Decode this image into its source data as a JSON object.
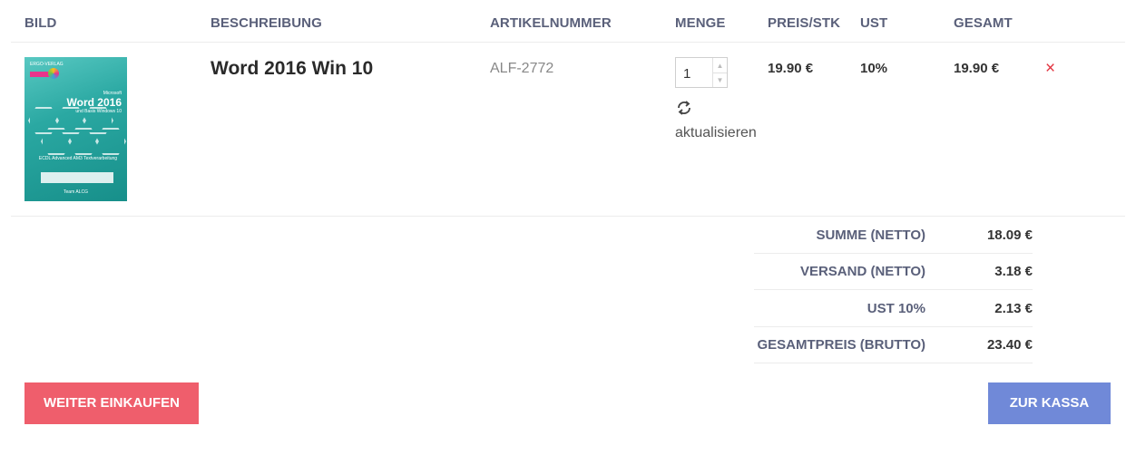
{
  "table": {
    "headers": [
      "BILD",
      "BESCHREIBUNG",
      "ARTIKELNUMMER",
      "MENGE",
      "PREIS/STK",
      "UST",
      "GESAMT"
    ]
  },
  "item": {
    "cover": {
      "publisher": "ERGO-VERLAG",
      "brand": "Microsoft",
      "title": "Word 2016",
      "subtitle": "und Basis Windows 10",
      "series": "ECDL Advanced AM3 Textverarbeitung",
      "author": "Team ALCG"
    },
    "description": "Word 2016 Win 10",
    "article_number": "ALF-2772",
    "quantity": "1",
    "update_label": "aktualisieren",
    "unit_price": "19.90 €",
    "vat": "10%",
    "total": "19.90 €",
    "remove_symbol": "×"
  },
  "summary": [
    {
      "label": "SUMME (NETTO)",
      "value": "18.09 €"
    },
    {
      "label": "VERSAND (NETTO)",
      "value": "3.18 €"
    },
    {
      "label": "UST 10%",
      "value": "2.13 €"
    },
    {
      "label": "GESAMTPREIS (BRUTTO)",
      "value": "23.40 €"
    }
  ],
  "actions": {
    "continue_shopping": "WEITER EINKAUFEN",
    "checkout": "ZUR KASSA"
  },
  "colors": {
    "continue_button": "#ef5e6c",
    "checkout_button": "#7089d8",
    "remove_icon": "#e2333f",
    "header_text": "#5a607a"
  }
}
